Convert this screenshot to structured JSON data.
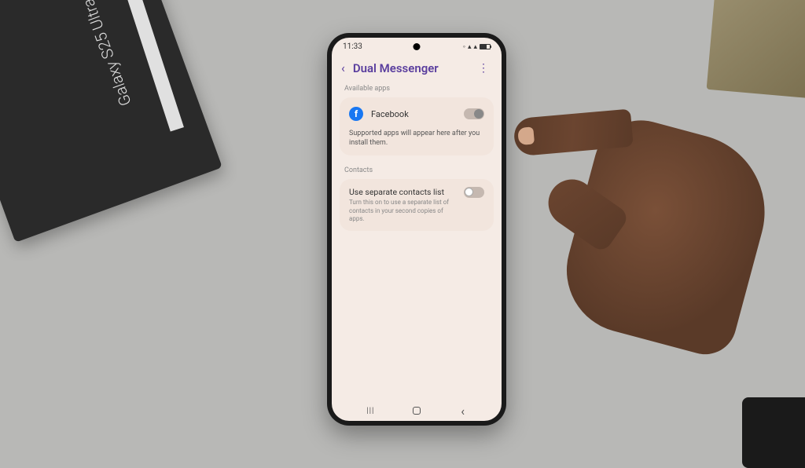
{
  "background": {
    "product_box_text": "Galaxy S25 Ultra"
  },
  "status_bar": {
    "time": "11:33"
  },
  "header": {
    "title": "Dual Messenger"
  },
  "sections": {
    "available_apps": {
      "label": "Available apps",
      "apps": [
        {
          "name": "Facebook",
          "icon": "facebook",
          "enabled": true
        }
      ],
      "help_text": "Supported apps will appear here after you install them."
    },
    "contacts": {
      "label": "Contacts",
      "title": "Use separate contacts list",
      "subtitle": "Turn this on to use a separate list of contacts in your second copies of apps.",
      "enabled": false
    }
  }
}
